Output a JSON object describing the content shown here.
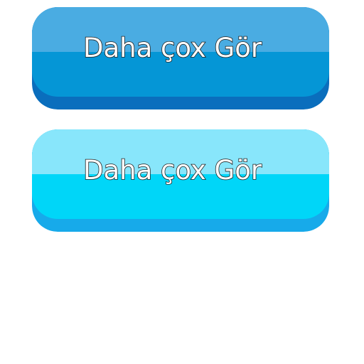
{
  "buttons": [
    {
      "label": "Daha çox Gör",
      "style": "dark-blue",
      "colors": {
        "base": "#0a6ebd",
        "body": "#0596d6",
        "gloss": "#4aace2"
      }
    },
    {
      "label": "Daha çox Gör",
      "style": "light-cyan",
      "colors": {
        "base": "#17aaea",
        "body": "#00d6f8",
        "gloss": "#88e6fb"
      }
    }
  ]
}
